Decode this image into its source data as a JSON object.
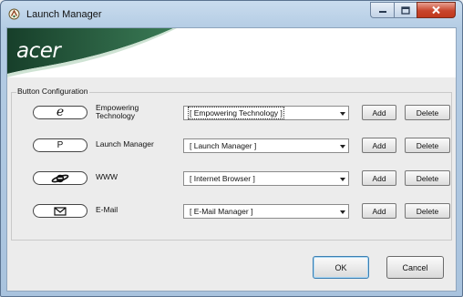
{
  "window": {
    "title": "Launch Manager",
    "brand_color": "#1f5c3c",
    "accent_color": "#3c7fb1"
  },
  "banner": {
    "logo_text": "acer",
    "background_color": "#2b6a47"
  },
  "button_config": {
    "legend": "Button Configuration",
    "rows": [
      {
        "icon": "e-icon",
        "icon_text": "e",
        "label_line1": "Empowering",
        "label_line2": "Technology",
        "combo_value": "[  Empowering Technology  ]",
        "add": "Add",
        "delete": "Delete"
      },
      {
        "icon": "p-key-icon",
        "icon_text": "P",
        "label_line1": "Launch Manager",
        "label_line2": "",
        "combo_value": "[  Launch Manager  ]",
        "add": "Add",
        "delete": "Delete"
      },
      {
        "icon": "internet-explorer-icon",
        "icon_text": "",
        "label_line1": "WWW",
        "label_line2": "",
        "combo_value": "[  Internet Browser  ]",
        "add": "Add",
        "delete": "Delete"
      },
      {
        "icon": "envelope-icon",
        "icon_text": "",
        "label_line1": "E-Mail",
        "label_line2": "",
        "combo_value": "[  E-Mail Manager  ]",
        "add": "Add",
        "delete": "Delete"
      }
    ]
  },
  "footer": {
    "ok_label": "OK",
    "cancel_label": "Cancel"
  }
}
